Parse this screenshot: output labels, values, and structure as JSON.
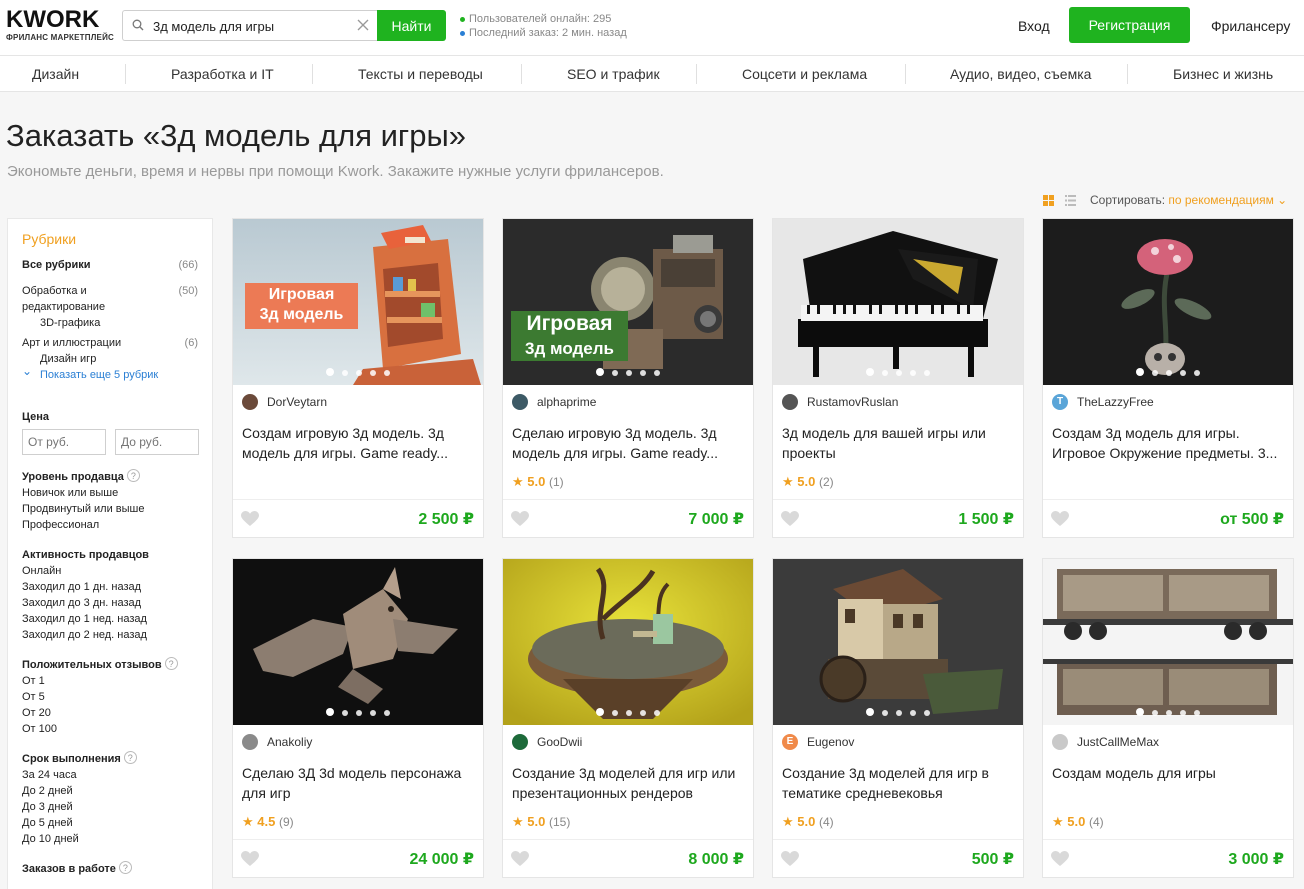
{
  "header": {
    "logo_text": "KWORK",
    "logo_sub": "ФРИЛАНС МАРКЕТПЛЕЙС",
    "search_value": "3д модель для игры",
    "search_button": "Найти",
    "stats_online": "Пользователей онлайн: 295",
    "stats_last_order": "Последний заказ: 2 мин. назад",
    "login": "Вход",
    "register": "Регистрация",
    "freelancer": "Фрилансеру"
  },
  "categories": [
    "Дизайн",
    "Разработка и IT",
    "Тексты и переводы",
    "SEO и трафик",
    "Соцсети и реклама",
    "Аудио, видео, съемка",
    "Бизнес и жизнь"
  ],
  "page": {
    "title": "Заказать «3д модель для игры»",
    "subtitle": "Экономьте деньги, время и нервы при помощи Kwork. Закажите нужные услуги фрилансеров.",
    "sort_label": "Сортировать:",
    "sort_value": "по рекомендациям ⌄"
  },
  "sidebar": {
    "heading": "Рубрики",
    "all": {
      "label": "Все рубрики",
      "count": "(66)"
    },
    "cat1": {
      "label_line1": "Обработка и",
      "label_line2": "редактирование",
      "count": "(50)",
      "sub": "3D-графика"
    },
    "cat2": {
      "label": "Арт и иллюстрации",
      "count": "(6)",
      "sub": "Дизайн игр"
    },
    "more": "Показать еще 5 рубрик",
    "price_label": "Цена",
    "price_from": "От руб.",
    "price_to": "До руб.",
    "level_label": "Уровень продавца",
    "level_items": [
      "Новичок или выше",
      "Продвинутый или выше",
      "Профессионал"
    ],
    "activity_label": "Активность продавцов",
    "activity_items": [
      "Онлайн",
      "Заходил до 1 дн. назад",
      "Заходил до 3 дн. назад",
      "Заходил до 1 нед. назад",
      "Заходил до 2 нед. назад"
    ],
    "reviews_label": "Положительных отзывов",
    "reviews_items": [
      "От 1",
      "От 5",
      "От 20",
      "От 100"
    ],
    "term_label": "Срок выполнения",
    "term_items": [
      "За 24 часа",
      "До 2 дней",
      "До 3 дней",
      "До 5 дней",
      "До 10 дней"
    ],
    "orders_label": "Заказов в работе",
    "help_mark": "?"
  },
  "cards": [
    {
      "seller": "DorVeytarn",
      "title_l1": "Создам игровую 3д модель. 3д",
      "title_l2": "модель для игры. Game ready...",
      "rating": "",
      "rating_count": "",
      "price": "2 500 ₽",
      "img_text_l1": "Игровая",
      "img_text_l2": "3д модель",
      "avatar_letter": ""
    },
    {
      "seller": "alphaprime",
      "title_l1": "Сделаю игровую 3д модель. 3д",
      "title_l2": "модель для игры. Game ready...",
      "rating": "5.0",
      "rating_count": "(1)",
      "price": "7 000 ₽",
      "img_text_l1": "Игровая",
      "img_text_l2": "3д модель",
      "avatar_letter": ""
    },
    {
      "seller": "RustamovRuslan",
      "title_l1": "3д модель для вашей игры или",
      "title_l2": "проекты",
      "rating": "5.0",
      "rating_count": "(2)",
      "price": "1 500 ₽",
      "avatar_letter": ""
    },
    {
      "seller": "TheLazzyFree",
      "title_l1": "Создам 3д модель для игры.",
      "title_l2": "Игровое Окружение предметы. 3...",
      "rating": "",
      "rating_count": "",
      "price": "от 500 ₽",
      "avatar_letter": "T"
    },
    {
      "seller": "Anakoliy",
      "title_l1": "Сделаю 3Д 3d модель персонажа",
      "title_l2": "для игр",
      "rating": "4.5",
      "rating_count": "(9)",
      "price": "24 000 ₽",
      "avatar_letter": ""
    },
    {
      "seller": "GooDwii",
      "title_l1": "Создание 3д моделей для игр или",
      "title_l2": "презентационных рендеров",
      "rating": "5.0",
      "rating_count": "(15)",
      "price": "8 000 ₽",
      "avatar_letter": ""
    },
    {
      "seller": "Eugenov",
      "title_l1": "Создание 3д моделей для игр в",
      "title_l2": "тематике средневековья",
      "rating": "5.0",
      "rating_count": "(4)",
      "price": "500 ₽",
      "avatar_letter": "E"
    },
    {
      "seller": "JustCallMeMax",
      "title_l1": "Создам модель для игры",
      "title_l2": "",
      "rating": "5.0",
      "rating_count": "(4)",
      "price": "3 000 ₽",
      "avatar_letter": ""
    }
  ],
  "colors": {
    "accent_green": "#1fb31f",
    "price_green": "#1ea81e",
    "accent_orange": "#f0a020",
    "link_blue": "#2a7fd4"
  },
  "icons": {
    "search": "search-icon",
    "clear": "clear-icon",
    "heart": "heart-icon",
    "star": "star-icon",
    "grid": "grid-view-icon",
    "list": "list-view-icon"
  }
}
